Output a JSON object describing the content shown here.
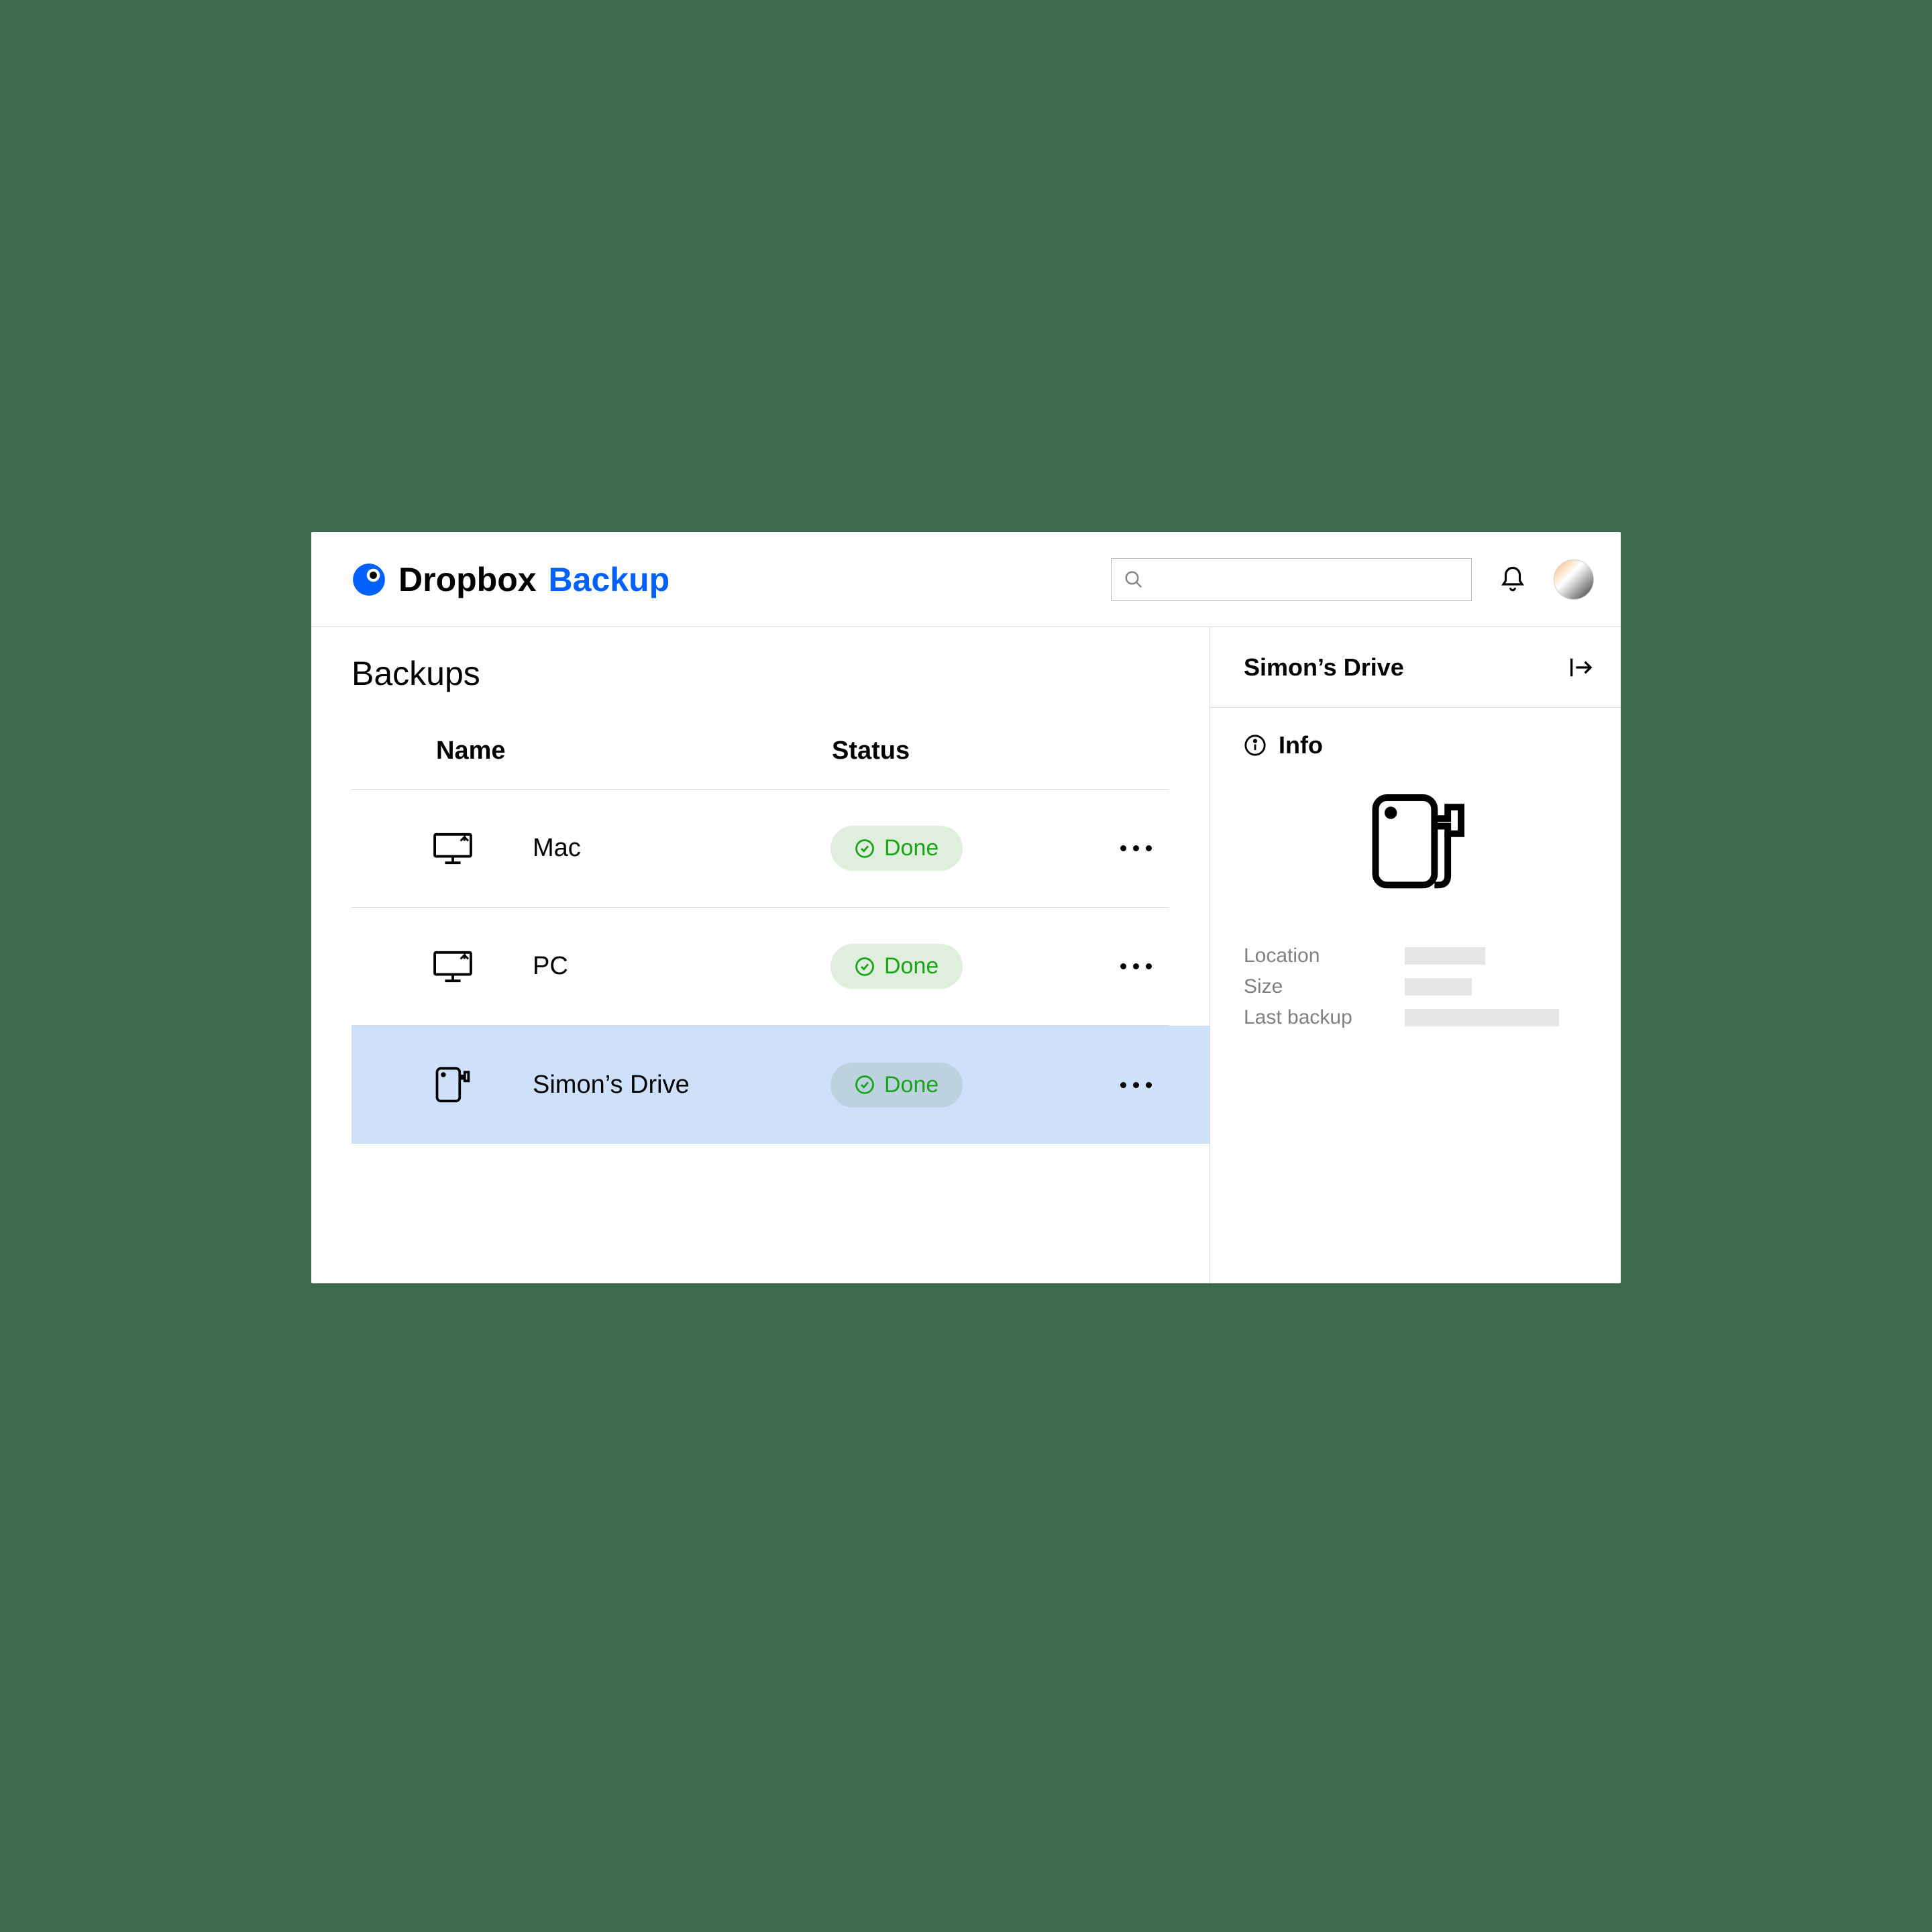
{
  "brand": {
    "name": "Dropbox",
    "product": "Backup"
  },
  "page": {
    "title": "Backups"
  },
  "table": {
    "columns": {
      "name": "Name",
      "status": "Status"
    },
    "rows": [
      {
        "name": "Mac",
        "status": "Done",
        "icon": "desktop-icon",
        "selected": false
      },
      {
        "name": "PC",
        "status": "Done",
        "icon": "desktop-icon",
        "selected": false
      },
      {
        "name": "Simon’s Drive",
        "status": "Done",
        "icon": "external-drive-icon",
        "selected": true
      }
    ]
  },
  "sidebar": {
    "title": "Simon’s Drive",
    "info_label": "Info",
    "fields": {
      "location": "Location",
      "size": "Size",
      "last_backup": "Last backup"
    }
  },
  "colors": {
    "accent": "#0061ff",
    "status_done": "#19a319",
    "selection": "#cee0fa",
    "background": "#3b6b4b"
  }
}
